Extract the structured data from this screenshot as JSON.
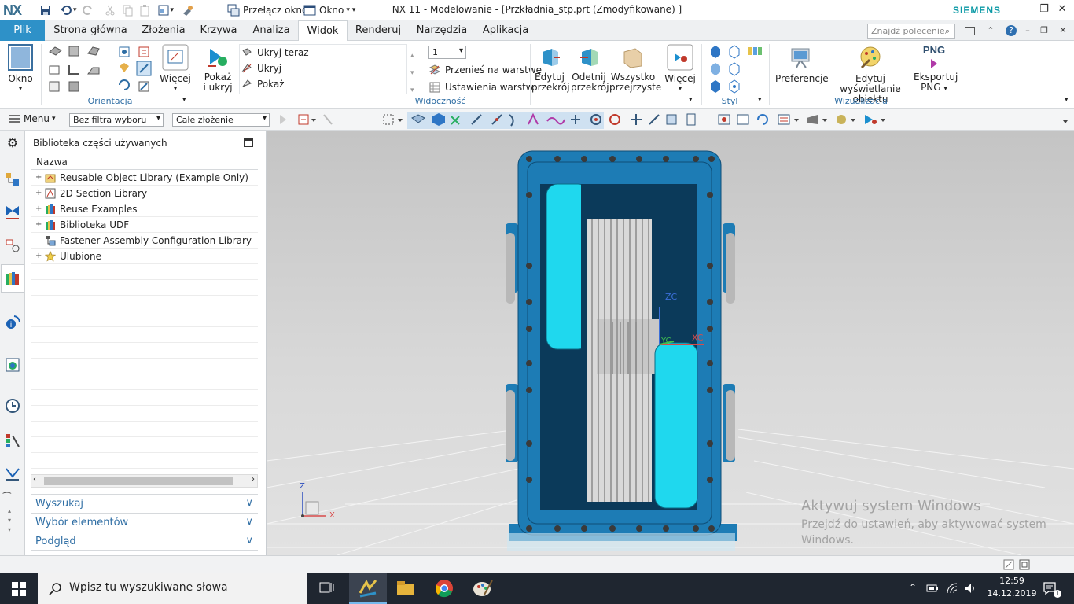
{
  "titlebar": {
    "logo": "NX",
    "switch_window": "Przełącz okno",
    "window_menu": "Okno",
    "title": "NX 11 - Modelowanie - [Przkładnia_stp.prt (Zmodyfikowane) ]",
    "brand": "SIEMENS"
  },
  "tabs": {
    "file": "Plik",
    "items": [
      "Strona główna",
      "Złożenia",
      "Krzywa",
      "Analiza",
      "Widok",
      "Renderuj",
      "Narzędzia",
      "Aplikacja"
    ],
    "active": "Widok",
    "search_placeholder": "Znajdź polecenie"
  },
  "ribbon": {
    "window_btn": "Okno",
    "more_btn": "Więcej",
    "orientation_group": "Orientacja",
    "show_hide_btn": [
      "Pokaż",
      "i ukryj"
    ],
    "hide_now": "Ukryj teraz",
    "hide": "Ukryj",
    "show": "Pokaż",
    "layer_value": "1",
    "move_to_layer": "Przenieś na warstwę",
    "layer_settings": "Ustawienia warstw",
    "visibility_group": "Widoczność",
    "edit_section": [
      "Edytuj",
      "przekrój"
    ],
    "clip_section": [
      "Odetnij",
      "przekrój"
    ],
    "all_transparent": [
      "Wszystko",
      "przejrzyste"
    ],
    "more_btn2": "Więcej",
    "style_group": "Styl",
    "preferences": "Preferencje",
    "edit_object_display": [
      "Edytuj wyświetlanie",
      "obiektu"
    ],
    "export_png": [
      "Eksportuj",
      "PNG"
    ],
    "png_label": "PNG",
    "visualization_group": "Wizualizacja"
  },
  "toolbar2": {
    "menu": "Menu",
    "filter": "Bez filtra wyboru",
    "scope": "Całe złożenie"
  },
  "panel": {
    "title": "Biblioteka części używanych",
    "column": "Nazwa",
    "items": [
      {
        "label": "Reusable Object Library (Example Only)",
        "expandable": true,
        "icon": "folder-library-icon"
      },
      {
        "label": "2D Section Library",
        "expandable": true,
        "icon": "section-library-icon"
      },
      {
        "label": "Reuse Examples",
        "expandable": true,
        "icon": "books-icon"
      },
      {
        "label": "Biblioteka UDF",
        "expandable": true,
        "icon": "books-icon"
      },
      {
        "label": "Fastener Assembly Configuration Library",
        "expandable": false,
        "icon": "fastener-icon"
      },
      {
        "label": "Ulubione",
        "expandable": true,
        "icon": "star-icon"
      }
    ],
    "accordion": [
      "Wyszukaj",
      "Wybór elementów",
      "Podgląd"
    ]
  },
  "viewport": {
    "axis_zc": "ZC",
    "axis_yc": "YC",
    "axis_xc": "XC",
    "triad_z": "Z",
    "triad_x": "X",
    "watermark_title": "Aktywuj system Windows",
    "watermark_text": "Przejdź do ustawień, aby aktywować system Windows."
  },
  "taskbar": {
    "search_placeholder": "Wpisz tu wyszukiwane słowa",
    "time": "12:59",
    "date": "14.12.2019"
  },
  "colors": {
    "accent": "#2e91c8",
    "housing": "#1d7cb5",
    "cyan_gear": "#1fd8ee"
  }
}
